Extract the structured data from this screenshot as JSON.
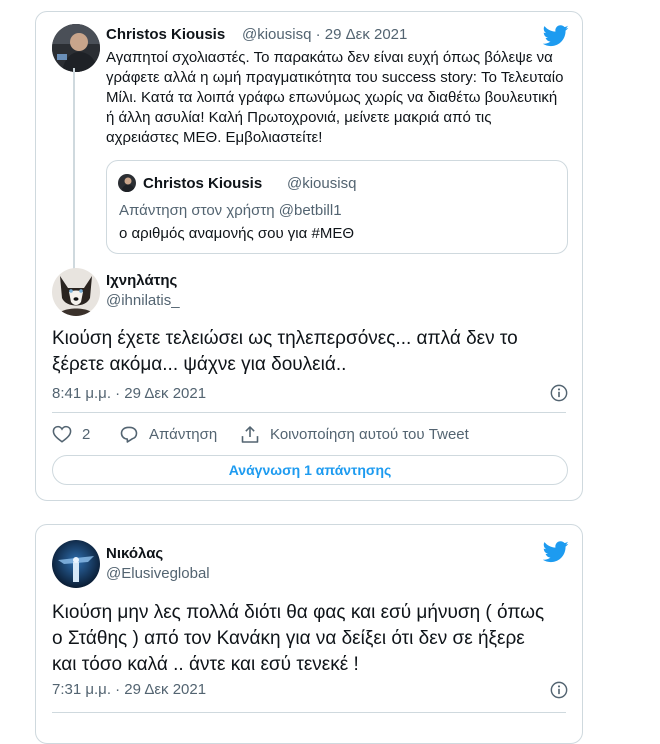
{
  "colors": {
    "accent": "#1d9bf0",
    "text": "#0f1419",
    "secondary": "#536471",
    "border": "#cfd9de"
  },
  "tweet1": {
    "author": {
      "name": "Christos Kiousis",
      "handle": "@kiousisq",
      "date": "29 Δεκ 2021",
      "separator": "·"
    },
    "text": "Αγαπητοί σχολιαστές. Το παρακάτω δεν είναι ευχή όπως βόλεψε να γράφετε αλλά η ωμή πραγματικότητα του success story: Το Τελευταίο Μίλι. Κατά τα λοιπά γράφω επωνύμως χωρίς να διαθέτω βουλευτική ή άλλη ασυλία! Καλή Πρωτοχρονιά, μείνετε μακριά από τις αχρειάστες ΜΕΘ. Εμβολιαστείτε!",
    "quote": {
      "name": "Christos Kiousis",
      "handle": "@kiousisq",
      "reply_to": "Απάντηση στον χρήστη @betbill1",
      "text": "ο αριθμός αναμονής σου για #ΜΕΘ"
    }
  },
  "reply1": {
    "author": {
      "name": "Ιχνηλάτης",
      "handle": "@ihnilatis_"
    },
    "text": "Κιούση έχετε τελειώσει ως τηλεπερσόνες... απλά δεν το ξέρετε ακόμα... ψάχνε για δουλειά..",
    "timestamp": "8:41 μ.μ. · 29 Δεκ 2021",
    "likes": "2",
    "reply_label": "Απάντηση",
    "share_label": "Κοινοποίηση αυτού του Tweet",
    "read_replies": "Ανάγνωση 1 απάντησης"
  },
  "tweet2": {
    "author": {
      "name": "Νικόλας",
      "handle": "@Elusiveglobal"
    },
    "text": "Κιούση μην λες πολλά διότι θα φας και εσύ μήνυση ( όπως ο Στάθης ) από τον Κανάκη για να δείξει ότι δεν σε ήξερε και τόσο καλά  .. άντε και εσύ τενεκέ !",
    "timestamp": "7:31 μ.μ. · 29 Δεκ 2021"
  },
  "icons": [
    "twitter-bird-icon",
    "info-icon",
    "heart-icon",
    "reply-icon",
    "share-icon"
  ]
}
